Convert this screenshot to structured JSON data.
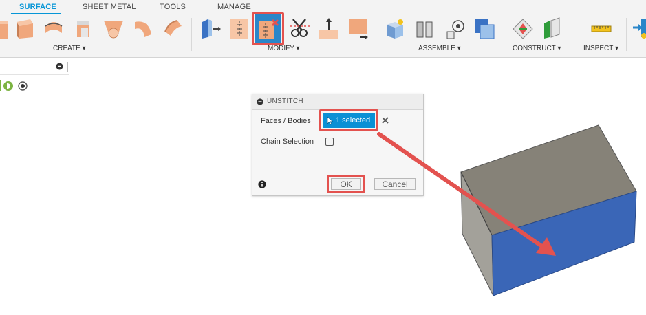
{
  "tabs": [
    "SURFACE",
    "SHEET METAL",
    "TOOLS",
    "MANAGE"
  ],
  "groups": {
    "create": "CREATE ▾",
    "modify": "MODIFY ▾",
    "assemble": "ASSEMBLE ▾",
    "construct": "CONSTRUCT ▾",
    "inspect": "INSPECT ▾"
  },
  "dialog": {
    "title": "UNSTITCH",
    "faces_label": "Faces / Bodies",
    "selection_value": "1 selected",
    "chain_label": "Chain Selection",
    "chain_checked": false,
    "ok_label": "OK",
    "cancel_label": "Cancel"
  },
  "colors": {
    "accent": "#0696d7",
    "highlight": "#e3524f",
    "face_selected": "#3a66b7",
    "body_top": "#868278",
    "body_side": "#a3a19a"
  }
}
